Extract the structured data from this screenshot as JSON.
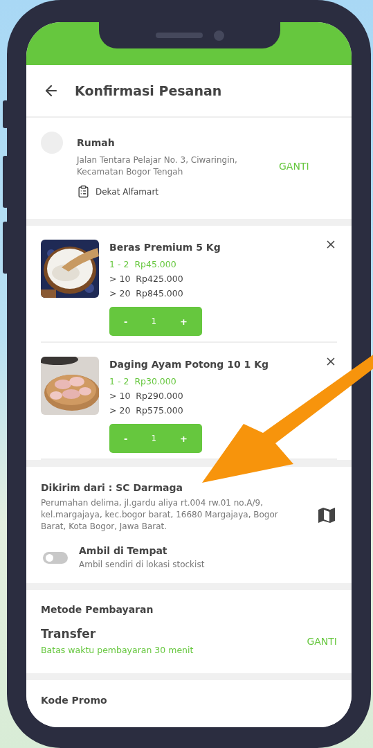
{
  "header": {
    "title": "Konfirmasi Pesanan"
  },
  "address": {
    "label": "Rumah",
    "detail": "Jalan Tentara Pelajar No. 3, Ciwaringin, Kecamatan Bogor Tengah",
    "note": "Dekat Alfamart",
    "action": "GANTI"
  },
  "items": [
    {
      "name": "Beras Premium 5 Kg",
      "tiers": [
        {
          "range": "1 - 2",
          "price": "Rp45.000",
          "selected": true
        },
        {
          "range": "> 10",
          "price": "Rp425.000",
          "selected": false
        },
        {
          "range": "> 20",
          "price": "Rp845.000",
          "selected": false
        }
      ],
      "quantity": {
        "minus": "-",
        "value": "1",
        "plus": "+"
      }
    },
    {
      "name": "Daging Ayam  Potong 10 1 Kg",
      "tiers": [
        {
          "range": "1 - 2",
          "price": "Rp30.000",
          "selected": true
        },
        {
          "range": "> 10",
          "price": "Rp290.000",
          "selected": false
        },
        {
          "range": "> 20",
          "price": "Rp575.000",
          "selected": false
        }
      ],
      "quantity": {
        "minus": "-",
        "value": "1",
        "plus": "+"
      }
    }
  ],
  "shipping": {
    "title": "Dikirim dari : SC Darmaga",
    "address": "Perumahan delima, jl.gardu aliya rt.004 rw.01 no.A/9, kel.margajaya, kec.bogor barat, 16680 Margajaya, Bogor Barat, Kota Bogor, Jawa Barat.",
    "pickup": {
      "label": "Ambil di Tempat",
      "hint": "Ambil sendiri di lokasi stockist",
      "on": false
    }
  },
  "payment": {
    "title": "Metode Pembayaran",
    "method": "Transfer",
    "deadline": "Batas waktu pembayaran 30 menit",
    "action": "GANTI"
  },
  "promo": {
    "title": "Kode Promo"
  }
}
